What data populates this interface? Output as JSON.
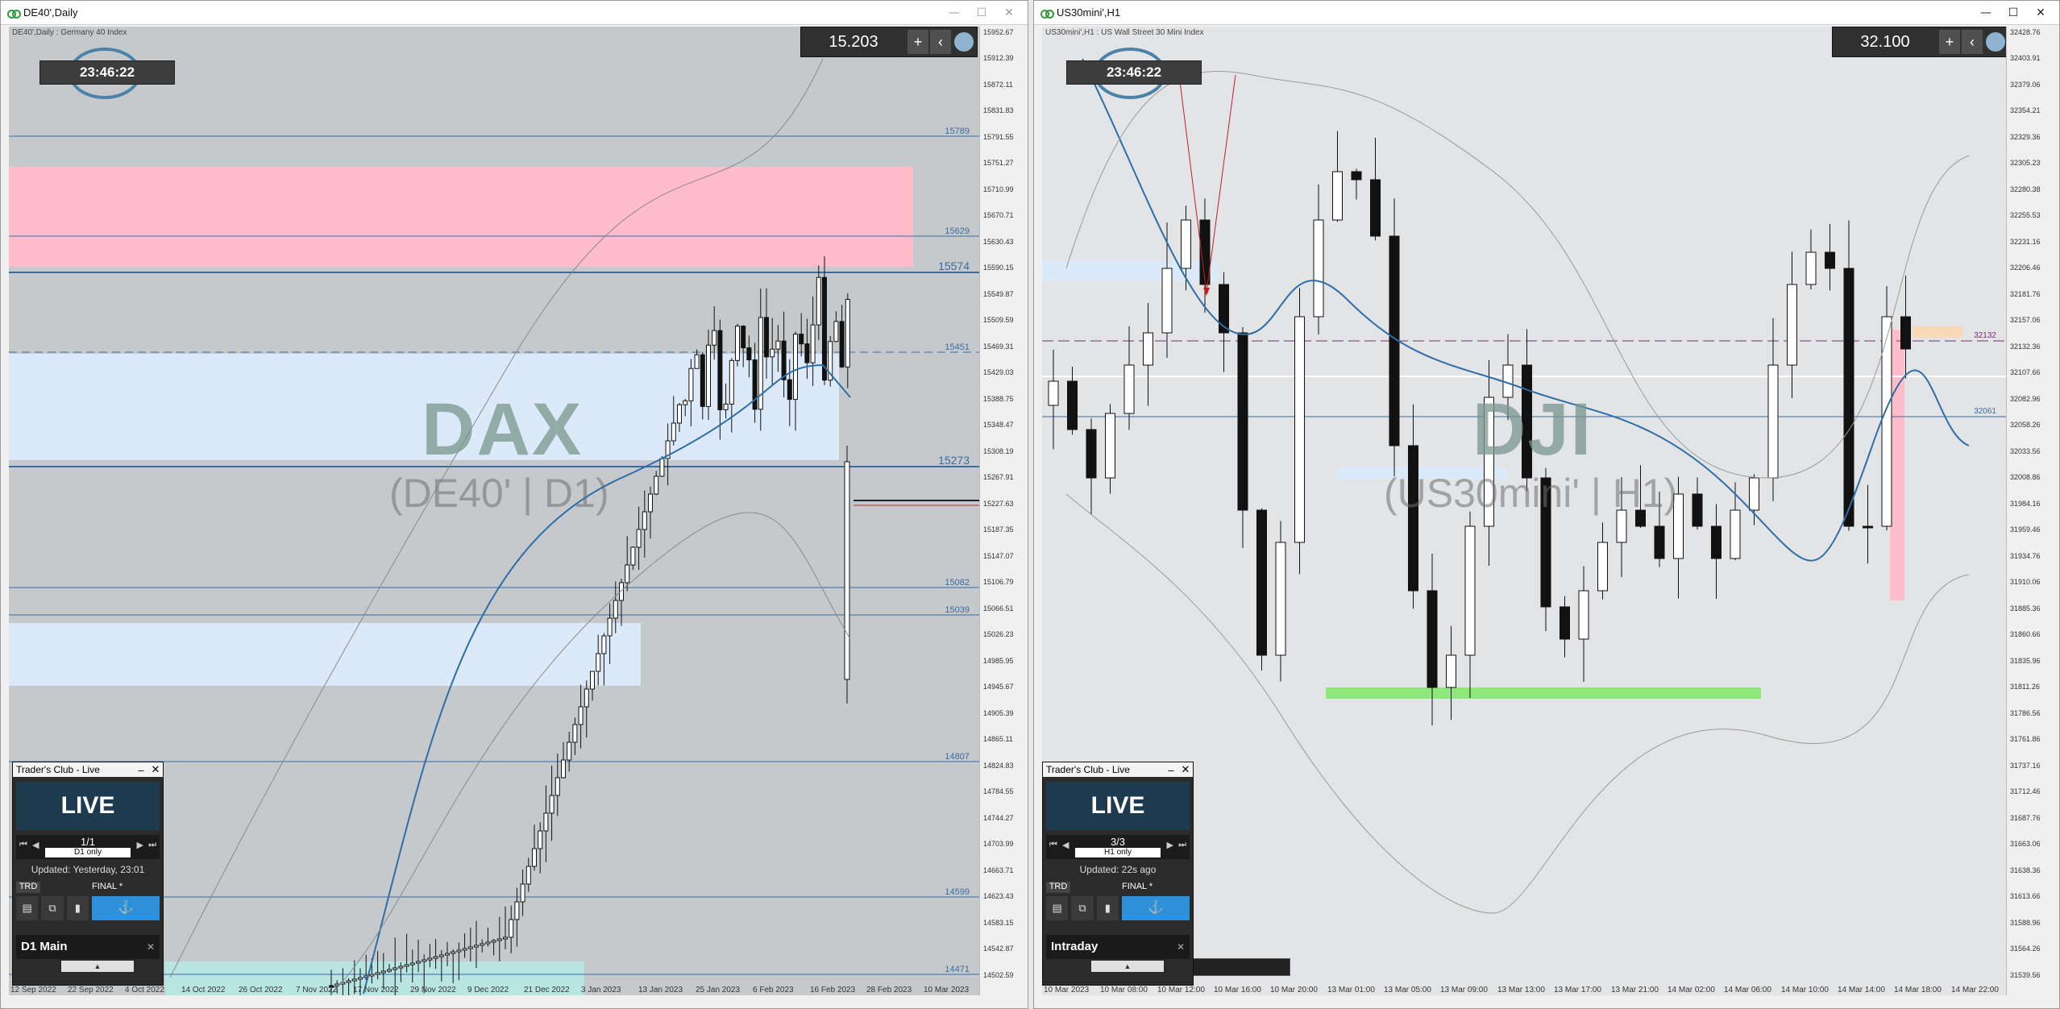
{
  "left_window": {
    "title": "DE40',Daily",
    "symbol_desc": "DE40',Daily :  Germany 40 Index",
    "watermark": "DAX",
    "watermark_sub": "(DE40' | D1)",
    "clock": "23:46:22",
    "spread": "15.203",
    "level_labels": [
      "15789",
      "15629",
      "15574",
      "15451",
      "15273",
      "15082",
      "15039",
      "14807",
      "14599",
      "14471"
    ],
    "price_labels": [
      "15952.67",
      "15912.39",
      "15872.11",
      "15831.83",
      "15791.55",
      "15751.27",
      "15710.99",
      "15670.71",
      "15630.43",
      "15590.15",
      "15549.87",
      "15509.59",
      "15469.31",
      "15429.03",
      "15388.75",
      "15348.47",
      "15308.19",
      "15267.91",
      "15227.63",
      "15187.35",
      "15147.07",
      "15106.79",
      "15066.51",
      "15026.23",
      "14985.95",
      "14945.67",
      "14905.39",
      "14865.11",
      "14824.83",
      "14784.55",
      "14744.27",
      "14703.99",
      "14663.71",
      "14623.43",
      "14583.15",
      "14542.87",
      "14502.59"
    ],
    "date_labels": [
      "12 Sep 2022",
      "22 Sep 2022",
      "4 Oct 2022",
      "14 Oct 2022",
      "26 Oct 2022",
      "7 Nov 2022",
      "17 Nov 2022",
      "29 Nov 2022",
      "9 Dec 2022",
      "21 Dec 2022",
      "3 Jan 2023",
      "13 Jan 2023",
      "25 Jan 2023",
      "6 Feb 2023",
      "16 Feb 2023",
      "28 Feb 2023",
      "10 Mar 2023"
    ],
    "panel": {
      "title": "Trader's Club - Live",
      "live": "LIVE",
      "count": "1/1",
      "filter": "D1 only",
      "updated": "Updated: Yesterday, 23:01",
      "trd": "TRD",
      "final": "FINAL *",
      "strategy": "D1 Main"
    }
  },
  "right_window": {
    "title": "US30mini',H1",
    "symbol_desc": "US30mini',H1 :  US Wall Street 30 Mini Index",
    "watermark": "DJI",
    "watermark_sub": "(US30mini' | H1)",
    "clock": "23:46:22",
    "spread": "32.100",
    "level_labels": [
      "32132",
      "32061"
    ],
    "price_labels": [
      "32428.76",
      "32403.91",
      "32379.06",
      "32354.21",
      "32329.36",
      "32305.23",
      "32280.38",
      "32255.53",
      "32231.16",
      "32206.46",
      "32181.76",
      "32157.06",
      "32132.36",
      "32107.66",
      "32082.96",
      "32058.26",
      "32033.56",
      "32008.86",
      "31984.16",
      "31959.46",
      "31934.76",
      "31910.06",
      "31885.36",
      "31860.66",
      "31835.96",
      "31811.26",
      "31786.56",
      "31761.86",
      "31737.16",
      "31712.46",
      "31687.76",
      "31663.06",
      "31638.36",
      "31613.66",
      "31588.96",
      "31564.26",
      "31539.56"
    ],
    "date_labels": [
      "10 Mar 2023",
      "10 Mar 08:00",
      "10 Mar 12:00",
      "10 Mar 16:00",
      "10 Mar 20:00",
      "13 Mar 01:00",
      "13 Mar 05:00",
      "13 Mar 09:00",
      "13 Mar 13:00",
      "13 Mar 17:00",
      "13 Mar 21:00",
      "14 Mar 02:00",
      "14 Mar 06:00",
      "14 Mar 10:00",
      "14 Mar 14:00",
      "14 Mar 18:00",
      "14 Mar 22:00"
    ],
    "panel": {
      "title": "Trader's Club - Live",
      "live": "LIVE",
      "count": "3/3",
      "filter": "H1 only",
      "updated": "Updated: 22s ago",
      "trd": "TRD",
      "final": "FINAL *",
      "strategy": "Intraday"
    }
  },
  "window_buttons": {
    "minimize": "—",
    "maximize": "☐",
    "close": "✕"
  },
  "colors": {
    "supply_zone": "#ffbccb",
    "demand_zone": "#dce9f8",
    "level_line": "#3a6aa0",
    "ma_line": "#2d6ea8",
    "green_zone": "#8ee87a"
  }
}
